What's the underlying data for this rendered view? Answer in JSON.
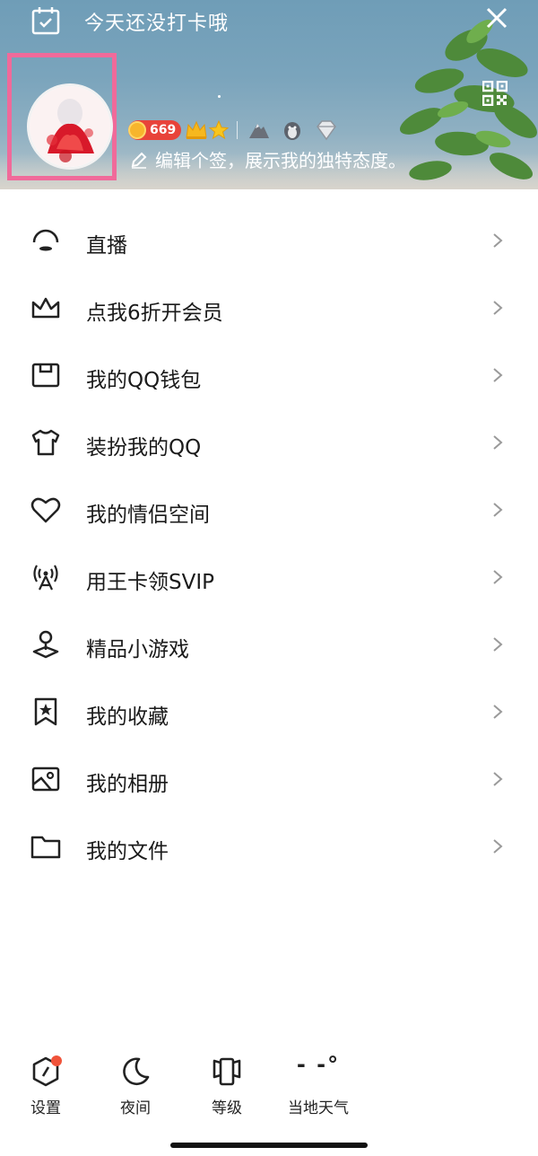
{
  "header": {
    "checkin_text": "今天还没打卡哦",
    "level_number": "669",
    "signature": "编辑个签，展示我的独特态度。"
  },
  "menu": [
    {
      "label": "直播",
      "icon": "live-icon"
    },
    {
      "label": "点我6折开会员",
      "icon": "crown-icon"
    },
    {
      "label": "我的QQ钱包",
      "icon": "wallet-icon"
    },
    {
      "label": "装扮我的QQ",
      "icon": "tshirt-icon"
    },
    {
      "label": "我的情侣空间",
      "icon": "heart-icon"
    },
    {
      "label": "用王卡领SVIP",
      "icon": "signal-tower-icon"
    },
    {
      "label": "精品小游戏",
      "icon": "game-icon"
    },
    {
      "label": "我的收藏",
      "icon": "bookmark-star-icon"
    },
    {
      "label": "我的相册",
      "icon": "photo-album-icon"
    },
    {
      "label": "我的文件",
      "icon": "folder-icon"
    }
  ],
  "bottom_bar": {
    "settings": "设置",
    "night": "夜间",
    "level": "等级",
    "weather": "当地天气",
    "weather_value": "- -°"
  },
  "colors": {
    "highlight_frame": "#f06a9a",
    "notification_dot": "#f0533a",
    "coin_badge": "#e8433a"
  }
}
